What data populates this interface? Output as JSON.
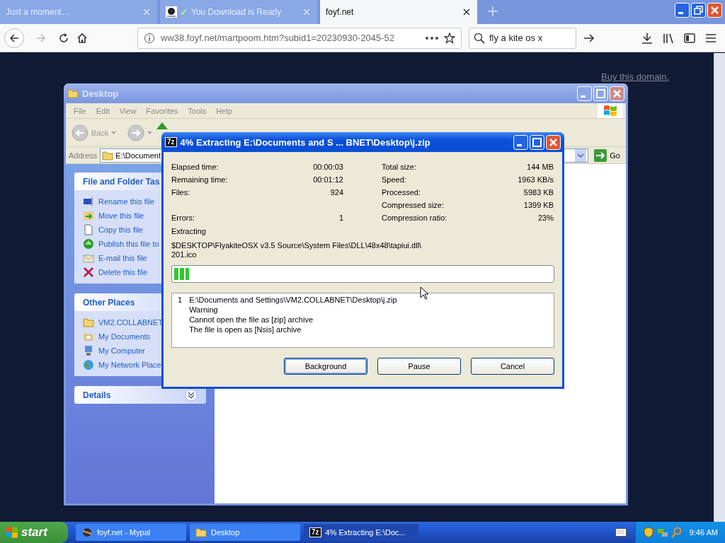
{
  "browser": {
    "tabs": [
      {
        "title": "Just a moment…",
        "selected": false
      },
      {
        "title": "You Download is Ready",
        "check": "✓",
        "selected": false
      },
      {
        "title": "foyf.net",
        "selected": true
      }
    ],
    "nav": {
      "forward_disabled": true,
      "url": "ww38.foyf.net/martpoom.htm?subid1=20230930-2045-52",
      "search": "fly a kite os x"
    },
    "page": {
      "link": "Buy this domain."
    }
  },
  "explorer": {
    "title": "Desktop",
    "menu": [
      "File",
      "Edit",
      "View",
      "Favorites",
      "Tools",
      "Help"
    ],
    "back": "Back",
    "address_label": "Address",
    "address": "E:\\Document",
    "go": "Go",
    "panels": [
      {
        "title": "File and Folder Tas",
        "expanded": true,
        "items": [
          "Rename this file",
          "Move this file",
          "Copy this file",
          "Publish this file to",
          "E-mail this file",
          "Delete this file"
        ]
      },
      {
        "title": "Other Places",
        "expanded": true,
        "items": [
          "VM2.COLLABNET",
          "My Documents",
          "My Computer",
          "My Network Place"
        ]
      },
      {
        "title": "Details",
        "expanded": false
      }
    ]
  },
  "dialog": {
    "icon_label": "7z",
    "title": "4% Extracting E:\\Documents and S ... BNET\\Desktop\\j.zip",
    "left": [
      {
        "label": "Elapsed time:",
        "value": "00:00:03"
      },
      {
        "label": "Remaining time:",
        "value": "00:01:12"
      },
      {
        "label": "Files:",
        "value": "924",
        "spacer_after": true
      },
      {
        "label": "Errors:",
        "value": "1"
      }
    ],
    "right": [
      {
        "label": "Total size:",
        "value": "144 MB"
      },
      {
        "label": "Speed:",
        "value": "1963 KB/s"
      },
      {
        "label": "Processed:",
        "value": "5983 KB"
      },
      {
        "label": "Compressed size:",
        "value": "1399 KB"
      },
      {
        "label": "Compression ratio:",
        "value": "23%"
      }
    ],
    "extracting_label": "Extracting",
    "path": [
      "$DESKTOP\\FlyakiteOSX v3.5 Source\\System Files\\DLL\\48x48\\tapiui.dll\\",
      "201.ico"
    ],
    "progress": {
      "level": 0.04
    },
    "messages": [
      {
        "number": "1",
        "lines": [
          "E:\\Documents and Settings\\VM2.COLLABNET\\Desktop\\j.zip",
          "Warning",
          "Cannot open the file as [zip] archive",
          "The file is open as [Nsis] archive"
        ]
      }
    ],
    "buttons": [
      {
        "label": "Background",
        "selected": true
      },
      {
        "label": "Pause",
        "selected": false
      },
      {
        "label": "Cancel",
        "selected": false
      }
    ]
  },
  "taskbar": {
    "start": "start",
    "tasks": [
      {
        "label": "foyf.net - Mypal",
        "selected": false
      },
      {
        "label": "Desktop",
        "selected": false
      },
      {
        "icon_label": "7z",
        "label": "4% Extracting E:\\Doc...",
        "selected": true
      }
    ],
    "clock": "9:46 AM"
  }
}
